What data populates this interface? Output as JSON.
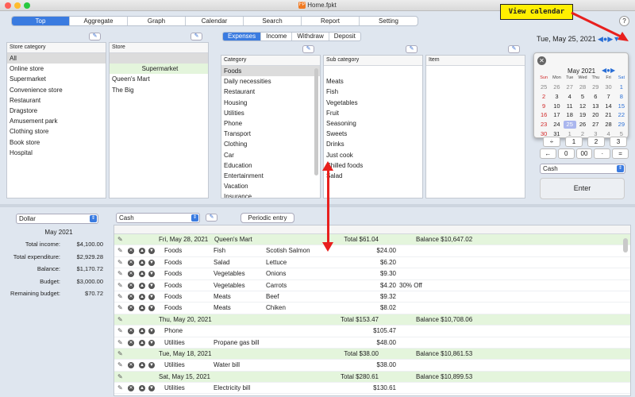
{
  "window": {
    "title": "Home.fpkt",
    "app_icon": "FP"
  },
  "tabs": [
    "Top",
    "Aggregate",
    "Graph",
    "Calendar",
    "Search",
    "Report",
    "Setting"
  ],
  "help": "?",
  "callout": "View calendar",
  "store_category": {
    "header": "Store category",
    "items": [
      "All",
      "Online store",
      "Supermarket",
      "Convenience store",
      "Restaurant",
      "Dragstore",
      "Amusement park",
      "Clothing store",
      "Book store",
      "Hospital"
    ]
  },
  "store": {
    "header": "Store",
    "items": [
      "",
      "Supermarket",
      "Queen's Mart",
      "The Big"
    ]
  },
  "type_tabs": [
    "Expenses",
    "Income",
    "Withdraw",
    "Deposit"
  ],
  "category": {
    "header": "Category",
    "items": [
      "Foods",
      "Daily necessities",
      "Restaurant",
      "Housing",
      "Utilities",
      "Phone",
      "Transport",
      "Clothing",
      "Car",
      "Education",
      "Entertainment",
      "Vacation",
      "Insurance"
    ]
  },
  "subcategory": {
    "header": "Sub category",
    "items": [
      "",
      "Meats",
      "Fish",
      "Vegetables",
      "Fruit",
      "Seasoning",
      "Sweets",
      "Drinks",
      "Just cook",
      "Chilled foods",
      "Salad"
    ]
  },
  "item": {
    "header": "Item"
  },
  "date": {
    "label": "Tue, May 25, 2021"
  },
  "calendar": {
    "month": "May 2021",
    "weekdays": [
      "Sun",
      "Mon",
      "Tue",
      "Wed",
      "Thu",
      "Fri",
      "Sat"
    ],
    "days": [
      "25",
      "26",
      "27",
      "28",
      "29",
      "30",
      "1",
      "2",
      "3",
      "4",
      "5",
      "6",
      "7",
      "8",
      "9",
      "10",
      "11",
      "12",
      "13",
      "14",
      "15",
      "16",
      "17",
      "18",
      "19",
      "20",
      "21",
      "22",
      "23",
      "24",
      "25",
      "26",
      "27",
      "28",
      "29",
      "30",
      "31",
      "1",
      "2",
      "3",
      "4",
      "5"
    ],
    "today": "25"
  },
  "keypad": {
    "row1": [
      "÷",
      "1",
      "2",
      "3"
    ],
    "row2": [
      "←",
      "0",
      "00",
      "·",
      "="
    ]
  },
  "payment": "Cash",
  "enter": "Enter",
  "currency": "Dollar",
  "summary": {
    "month": "May 2021",
    "rows": [
      [
        "Total income:",
        "$4,100.00"
      ],
      [
        "Total expenditure:",
        "$2,929.28"
      ],
      [
        "Balance:",
        "$1,170.72"
      ],
      [
        "Budget:",
        "$3,000.00"
      ],
      [
        "Remaining budget:",
        "$70.72"
      ]
    ]
  },
  "ledger_account": "Cash",
  "periodic": "Periodic entry",
  "ledger": [
    {
      "type": "day",
      "date": "Fri, May 28, 2021",
      "store": "Queen's Mart",
      "total": "Total $61.04",
      "balance": "Balance $10,647.02"
    },
    {
      "type": "entry",
      "cat": "Foods",
      "sub": "Fish",
      "item": "Scotish Salmon",
      "amount": "$24.00",
      "note": ""
    },
    {
      "type": "entry",
      "cat": "Foods",
      "sub": "Salad",
      "item": "Lettuce",
      "amount": "$6.20",
      "note": ""
    },
    {
      "type": "entry",
      "cat": "Foods",
      "sub": "Vegetables",
      "item": "Onions",
      "amount": "$9.30",
      "note": ""
    },
    {
      "type": "entry",
      "cat": "Foods",
      "sub": "Vegetables",
      "item": "Carrots",
      "amount": "$4.20",
      "note": "30% Off"
    },
    {
      "type": "entry",
      "cat": "Foods",
      "sub": "Meats",
      "item": "Beef",
      "amount": "$9.32",
      "note": ""
    },
    {
      "type": "entry",
      "cat": "Foods",
      "sub": "Meats",
      "item": "Chiken",
      "amount": "$8.02",
      "note": ""
    },
    {
      "type": "day",
      "date": "Thu, May 20, 2021",
      "store": "",
      "total": "Total $153.47",
      "balance": "Balance $10,708.06"
    },
    {
      "type": "entry",
      "cat": "Phone",
      "sub": "",
      "item": "",
      "amount": "$105.47",
      "note": ""
    },
    {
      "type": "entry",
      "cat": "Utilities",
      "sub": "Propane gas bill",
      "item": "",
      "amount": "$48.00",
      "note": ""
    },
    {
      "type": "day",
      "date": "Tue, May 18, 2021",
      "store": "",
      "total": "Total $38.00",
      "balance": "Balance $10,861.53"
    },
    {
      "type": "entry",
      "cat": "Utilities",
      "sub": "Water bill",
      "item": "",
      "amount": "$38.00",
      "note": ""
    },
    {
      "type": "day",
      "date": "Sat, May 15, 2021",
      "store": "",
      "total": "Total $280.61",
      "balance": "Balance $10,899.53"
    },
    {
      "type": "entry",
      "cat": "Utilities",
      "sub": "Electricity bill",
      "item": "",
      "amount": "$130.61",
      "note": ""
    }
  ]
}
